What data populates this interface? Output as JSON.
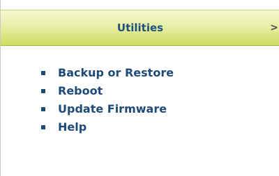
{
  "header": {
    "title": "Utilities",
    "chevron_glyph": ">",
    "chevron_icon": "chevron-right-icon"
  },
  "menu": {
    "items": [
      {
        "label": "Backup or Restore"
      },
      {
        "label": "Reboot"
      },
      {
        "label": "Update Firmware"
      },
      {
        "label": "Help"
      }
    ]
  },
  "colors": {
    "title_text": "#1f4f7d",
    "link_text": "#1e4a78",
    "header_gradient_top": "#f4f8cf",
    "header_gradient_bottom": "#cedd5f"
  }
}
